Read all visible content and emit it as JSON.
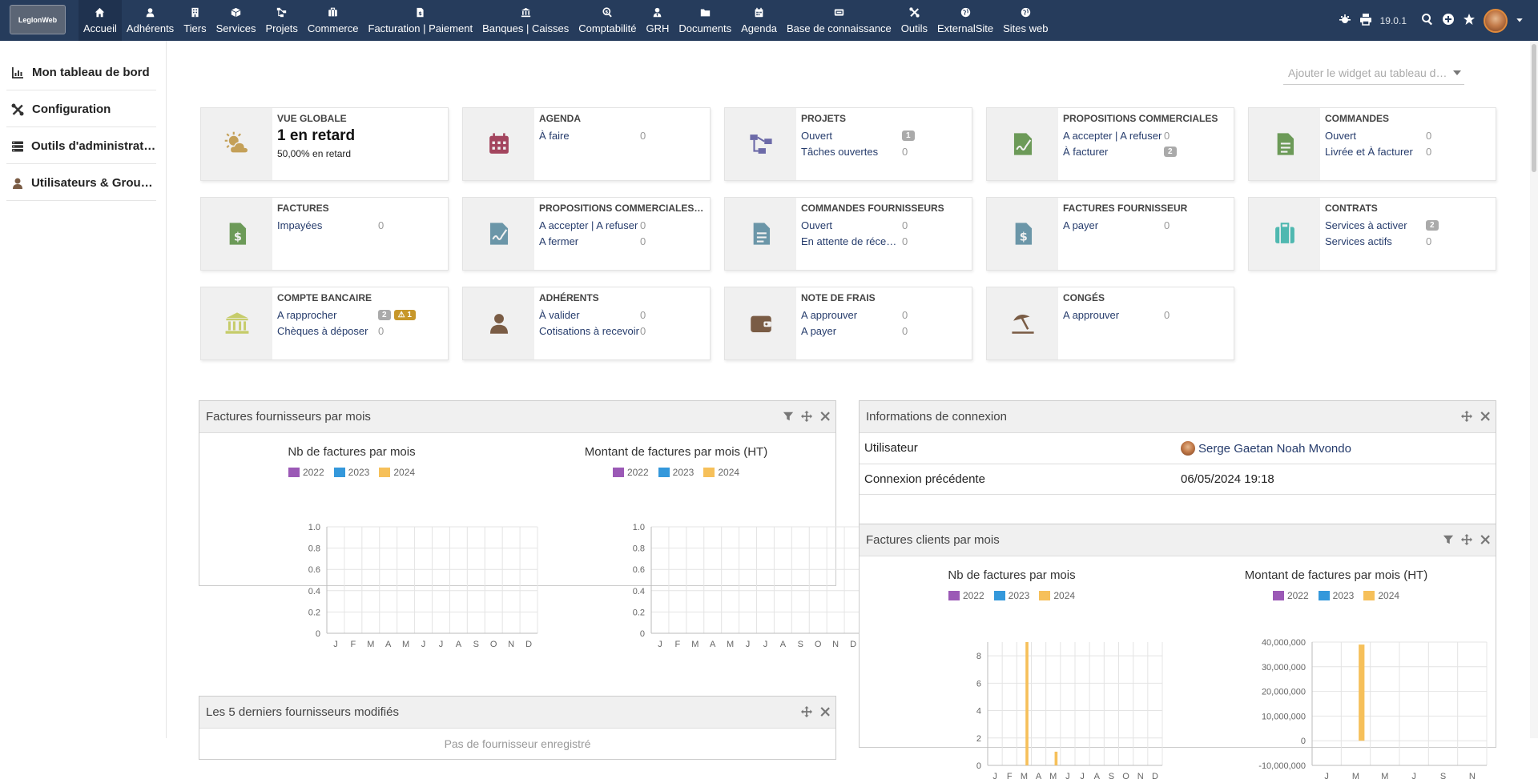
{
  "logo": {
    "text": "LeglonWeb"
  },
  "menu": [
    {
      "label": "Accueil",
      "icon": "home-icon"
    },
    {
      "label": "Adhérents",
      "icon": "user-icon"
    },
    {
      "label": "Tiers",
      "icon": "building-icon"
    },
    {
      "label": "Services",
      "icon": "cube-icon"
    },
    {
      "label": "Projets",
      "icon": "sitemap-icon"
    },
    {
      "label": "Commerce",
      "icon": "briefcase-icon"
    },
    {
      "label": "Facturation | Paiement",
      "icon": "invoice-icon"
    },
    {
      "label": "Banques | Caisses",
      "icon": "bank-icon"
    },
    {
      "label": "Comptabilité",
      "icon": "search-dollar-icon"
    },
    {
      "label": "GRH",
      "icon": "user-tie-icon"
    },
    {
      "label": "Documents",
      "icon": "folder-icon"
    },
    {
      "label": "Agenda",
      "icon": "calendar-icon"
    },
    {
      "label": "Base de connaissance",
      "icon": "ticket-icon"
    },
    {
      "label": "Outils",
      "icon": "tools-icon"
    },
    {
      "label": "ExternalSite",
      "icon": "globe-icon"
    },
    {
      "label": "Sites web",
      "icon": "globe-icon"
    }
  ],
  "topright": {
    "version": "19.0.1"
  },
  "sidebar": [
    {
      "label": "Mon tableau de bord",
      "icon": "chart-icon"
    },
    {
      "label": "Configuration",
      "icon": "tools-icon"
    },
    {
      "label": "Outils d'administration",
      "icon": "server-icon"
    },
    {
      "label": "Utilisateurs & Groupes",
      "icon": "user-icon"
    }
  ],
  "widget_select": {
    "placeholder": "Ajouter le widget au tableau de bord"
  },
  "boxes": {
    "vue": {
      "title": "VUE GLOBALE",
      "late": "1 en retard",
      "sub": "50,00% en retard"
    },
    "agenda": {
      "title": "AGENDA",
      "l1": "À faire",
      "v1": "0"
    },
    "projets": {
      "title": "PROJETS",
      "l1": "Ouvert",
      "b1": "1",
      "l2": "Tâches ouvertes",
      "v2": "0"
    },
    "propc": {
      "title": "PROPOSITIONS COMMERCIALES",
      "l1": "A accepter | A refuser",
      "v1": "0",
      "l2": "À facturer",
      "b2": "2"
    },
    "commandes": {
      "title": "COMMANDES",
      "l1": "Ouvert",
      "v1": "0",
      "l2": "Livrée et À facturer",
      "v2": "0"
    },
    "factures": {
      "title": "FACTURES",
      "l1": "Impayées",
      "v1": "0"
    },
    "propf": {
      "title": "PROPOSITIONS COMMERCIALES FOURNISSEURS",
      "l1": "A accepter | A refuser",
      "v1": "0",
      "l2": "A fermer",
      "v2": "0"
    },
    "cmdf": {
      "title": "COMMANDES FOURNISSEURS",
      "l1": "Ouvert",
      "v1": "0",
      "l2": "En attente de réception",
      "v2": "0"
    },
    "factf": {
      "title": "FACTURES FOURNISSEUR",
      "l1": "A payer",
      "v1": "0"
    },
    "contrats": {
      "title": "CONTRATS",
      "l1": "Services à activer",
      "b1": "2",
      "l2": "Services actifs",
      "v2": "0"
    },
    "banque": {
      "title": "COMPTE BANCAIRE",
      "l1": "A rapprocher",
      "b1": "2",
      "w1": "1",
      "l2": "Chèques à déposer",
      "v2": "0"
    },
    "adherents": {
      "title": "ADHÉRENTS",
      "l1": "À valider",
      "v1": "0",
      "l2": "Cotisations à recevoir",
      "v2": "0"
    },
    "ndf": {
      "title": "NOTE DE FRAIS",
      "l1": "A approuver",
      "v1": "0",
      "l2": "A payer",
      "v2": "0"
    },
    "conges": {
      "title": "CONGÉS",
      "l1": "A approuver",
      "v1": "0"
    }
  },
  "panel_ff": {
    "title": "Factures fournisseurs par mois"
  },
  "panel_info": {
    "title": "Informations de connexion",
    "user_label": "Utilisateur",
    "user_value": "Serge Gaetan Noah Mvondo",
    "prev_label": "Connexion précédente",
    "prev_value": "06/05/2024 19:18"
  },
  "panel_fc": {
    "title": "Factures clients par mois"
  },
  "panel_last": {
    "title": "Les 5 derniers fournisseurs modifiés",
    "empty": "Pas de fournisseur enregistré"
  },
  "colors": {
    "2022": "#9b59b6",
    "2023": "#3498db",
    "2024": "#f6c05a"
  },
  "chart_data": [
    {
      "type": "bar",
      "title": "Nb de factures par mois",
      "categories": [
        "J",
        "F",
        "M",
        "A",
        "M",
        "J",
        "J",
        "A",
        "S",
        "O",
        "N",
        "D"
      ],
      "series": [
        {
          "name": "2022",
          "values": [
            0,
            0,
            0,
            0,
            0,
            0,
            0,
            0,
            0,
            0,
            0,
            0
          ]
        },
        {
          "name": "2023",
          "values": [
            0,
            0,
            0,
            0,
            0,
            0,
            0,
            0,
            0,
            0,
            0,
            0
          ]
        },
        {
          "name": "2024",
          "values": [
            0,
            0,
            0,
            0,
            0,
            0,
            0,
            0,
            0,
            0,
            0,
            0
          ]
        }
      ],
      "ylim": [
        0,
        1
      ],
      "yticks": [
        "0",
        "0.2",
        "0.4",
        "0.6",
        "0.8",
        "1.0"
      ],
      "grid": true,
      "legend": "top"
    },
    {
      "type": "bar",
      "title": "Montant de factures par mois (HT)",
      "categories": [
        "J",
        "F",
        "M",
        "A",
        "M",
        "J",
        "J",
        "A",
        "S",
        "O",
        "N",
        "D"
      ],
      "series": [
        {
          "name": "2022",
          "values": [
            0,
            0,
            0,
            0,
            0,
            0,
            0,
            0,
            0,
            0,
            0,
            0
          ]
        },
        {
          "name": "2023",
          "values": [
            0,
            0,
            0,
            0,
            0,
            0,
            0,
            0,
            0,
            0,
            0,
            0
          ]
        },
        {
          "name": "2024",
          "values": [
            0,
            0,
            0,
            0,
            0,
            0,
            0,
            0,
            0,
            0,
            0,
            0
          ]
        }
      ],
      "ylim": [
        0,
        1
      ],
      "yticks": [
        "0",
        "0.2",
        "0.4",
        "0.6",
        "0.8",
        "1.0"
      ],
      "grid": true,
      "legend": "top"
    },
    {
      "type": "bar",
      "title": "Nb de factures par mois",
      "categories": [
        "J",
        "F",
        "M",
        "A",
        "M",
        "J",
        "J",
        "A",
        "S",
        "O",
        "N",
        "D"
      ],
      "series": [
        {
          "name": "2022",
          "values": [
            0,
            0,
            0,
            0,
            0,
            0,
            0,
            0,
            0,
            0,
            0,
            0
          ]
        },
        {
          "name": "2023",
          "values": [
            0,
            0,
            0,
            0,
            0,
            0,
            0,
            0,
            0,
            0,
            0,
            0
          ]
        },
        {
          "name": "2024",
          "values": [
            0,
            0,
            9,
            0,
            1,
            0,
            0,
            0,
            0,
            0,
            0,
            0
          ]
        }
      ],
      "ylim": [
        0,
        9
      ],
      "yticks": [
        "0",
        "2",
        "4",
        "6",
        "8"
      ],
      "grid": true,
      "legend": "top"
    },
    {
      "type": "bar",
      "title": "Montant de factures par mois (HT)",
      "categories": [
        "J",
        "M",
        "M",
        "J",
        "S",
        "N"
      ],
      "series": [
        {
          "name": "2022",
          "values": [
            0,
            0,
            0,
            0,
            0,
            0
          ]
        },
        {
          "name": "2023",
          "values": [
            0,
            0,
            0,
            0,
            0,
            0
          ]
        },
        {
          "name": "2024",
          "values": [
            0,
            39000000,
            0,
            0,
            0,
            0
          ]
        }
      ],
      "ylim": [
        -10000000,
        40000000
      ],
      "yticks": [
        "-10,000,000",
        "0",
        "10,000,000",
        "20,000,000",
        "30,000,000",
        "40,000,000"
      ],
      "grid": true,
      "legend": "top"
    }
  ]
}
